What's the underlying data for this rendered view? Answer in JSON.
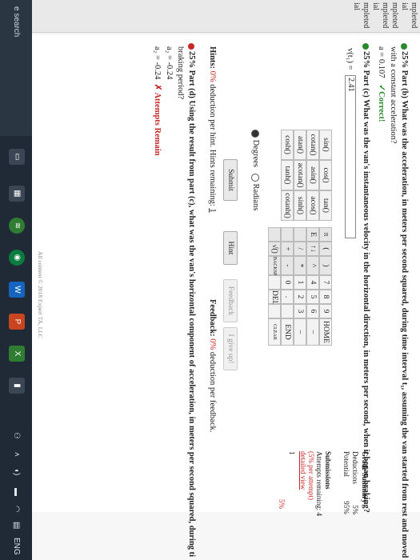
{
  "sidebar": [
    "mpleted",
    "ial",
    "mpleted",
    "mpleted",
    "ial",
    "mpleted",
    "ial"
  ],
  "part_d_prev": {
    "header": "25% Part (b)  What was the acceleration, in meters per second squared, during time interval t₁, assuming the van started from rest and moved",
    "header2": "with a constant acceleration?",
    "answer": "a = 0.107",
    "status": "✓Correct!"
  },
  "part_c": {
    "header": "25% Part (c)  What was the van's instantaneous velocity in the horizontal direction, in meters per second, when it began braking?",
    "label": "v(t₁) =",
    "value": "2.41"
  },
  "keypad": {
    "funcs": [
      [
        "sin()",
        "cos()",
        "tan()"
      ],
      [
        "cotan()",
        "asin()",
        "acos()"
      ],
      [
        "atan()",
        "acotan()",
        "sinh()"
      ],
      [
        "cosh()",
        "tanh()",
        "cotanh()"
      ]
    ],
    "keys": [
      [
        "π",
        "(",
        ")",
        "7",
        "8",
        "9",
        "HOME"
      ],
      [
        "E",
        "↑↓",
        "^",
        "4",
        "5",
        "6",
        "–"
      ],
      [
        "",
        "/",
        "*",
        "1",
        "2",
        "3",
        "–"
      ],
      [
        "",
        "+",
        "-",
        "0",
        ".",
        "",
        "END"
      ],
      [
        "",
        "√()",
        "BACKSPACE",
        "",
        "DEL",
        "",
        "CLEAR"
      ]
    ],
    "degrees": "Degrees",
    "radians": "Radians"
  },
  "buttons": {
    "submit": "Submit",
    "hint": "Hint",
    "feedback": "Feedback",
    "giveup": "I give up!"
  },
  "hints_line": {
    "lead": "Hints:",
    "pct": "0%",
    "text": " deduction per hint. Hints remaining: ",
    "remaining": "1"
  },
  "feedback_line": {
    "lead": "Feedback:",
    "pct": "0%",
    "text": " deduction per feedback."
  },
  "grade_summary": {
    "title": "Grade Summary",
    "rows": [
      [
        "Deductions",
        "5%"
      ],
      [
        "Potential",
        "95%"
      ]
    ],
    "submissions_title": "Submissions",
    "submissions_lines": [
      "Attempts remaining: 4",
      "(5% per attempt)",
      "detailed view"
    ],
    "attempt_no": "1",
    "attempt_pct": "5%"
  },
  "part_d": {
    "header": "25% Part (d)  Using the result from part (c), what was the van's horizontal component of acceleration, in meters per second squared, during ti",
    "header2": "braking period?",
    "line1": "a₂ = -0.24",
    "line2": "a₂ = -0.24",
    "status": "✗ Attempts Remain"
  },
  "footer": "All content © 2018 Expert TA, LLC",
  "taskbar": {
    "search": "e search",
    "tray_lang": "ENG",
    "colors": {
      "bar": "#1f2a36"
    }
  }
}
